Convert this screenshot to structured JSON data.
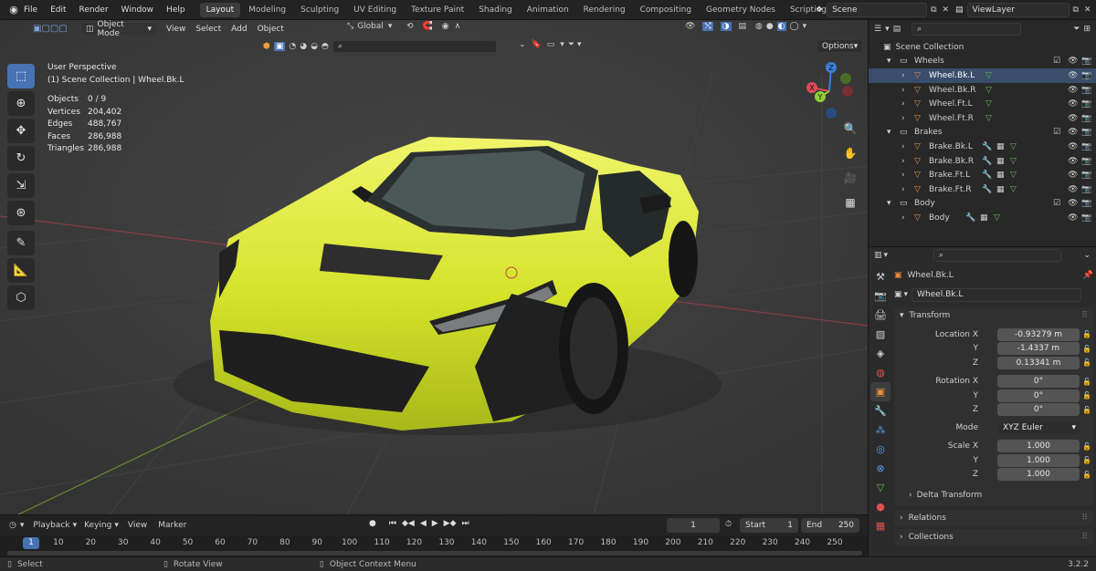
{
  "topbar": {
    "menus": [
      "File",
      "Edit",
      "Render",
      "Window",
      "Help"
    ],
    "workspaces": [
      "Layout",
      "Modeling",
      "Sculpting",
      "UV Editing",
      "Texture Paint",
      "Shading",
      "Animation",
      "Rendering",
      "Compositing",
      "Geometry Nodes",
      "Scripting"
    ],
    "active_workspace": "Layout",
    "add_workspace": "+",
    "scene_name": "Scene",
    "view_layer": "ViewLayer"
  },
  "viewport_header": {
    "mode": "Object Mode",
    "menus": [
      "View",
      "Select",
      "Add",
      "Object"
    ],
    "orientation": "Global",
    "options_label": "Options"
  },
  "viewport_info": {
    "perspective": "User Perspective",
    "context": "(1) Scene Collection | Wheel.Bk.L",
    "stats": [
      {
        "label": "Objects",
        "value": "0 / 9"
      },
      {
        "label": "Vertices",
        "value": "204,402"
      },
      {
        "label": "Edges",
        "value": "488,767"
      },
      {
        "label": "Faces",
        "value": "286,988"
      },
      {
        "label": "Triangles",
        "value": "286,988"
      }
    ]
  },
  "gizmo": {
    "x": "X",
    "y": "Y",
    "z": "Z"
  },
  "timeline": {
    "menus": [
      "Playback",
      "Keying",
      "View",
      "Marker"
    ],
    "current_frame": "1",
    "start_label": "Start",
    "start": "1",
    "end_label": "End",
    "end": "250",
    "playhead": "1",
    "ticks": [
      "10",
      "20",
      "30",
      "40",
      "50",
      "60",
      "70",
      "80",
      "90",
      "100",
      "110",
      "120",
      "130",
      "140",
      "150",
      "160",
      "170",
      "180",
      "190",
      "200",
      "210",
      "220",
      "230",
      "240",
      "250"
    ]
  },
  "statusbar": {
    "select": "Select",
    "rotate": "Rotate View",
    "context_menu": "Object Context Menu",
    "version": "3.2.2"
  },
  "outliner": {
    "root": "Scene Collection",
    "collections": [
      {
        "name": "Wheels",
        "objects": [
          "Wheel.Bk.L",
          "Wheel.Bk.R",
          "Wheel.Ft.L",
          "Wheel.Ft.R"
        ]
      },
      {
        "name": "Brakes",
        "objects": [
          "Brake.Bk.L",
          "Brake.Bk.R",
          "Brake.Ft.L",
          "Brake.Ft.R"
        ]
      },
      {
        "name": "Body",
        "objects": [
          "Body"
        ]
      }
    ]
  },
  "properties": {
    "object_name": "Wheel.Bk.L",
    "data_name": "Wheel.Bk.L",
    "transform_title": "Transform",
    "location": {
      "label_x": "Location X",
      "label_y": "Y",
      "label_z": "Z",
      "x": "-0.93279 m",
      "y": "-1.4337 m",
      "z": "0.13341 m"
    },
    "rotation": {
      "label_x": "Rotation X",
      "label_y": "Y",
      "label_z": "Z",
      "x": "0°",
      "y": "0°",
      "z": "0°"
    },
    "mode_label": "Mode",
    "mode_value": "XYZ Euler",
    "scale": {
      "label_x": "Scale X",
      "label_y": "Y",
      "label_z": "Z",
      "x": "1.000",
      "y": "1.000",
      "z": "1.000"
    },
    "delta_transform": "Delta Transform",
    "relations": "Relations",
    "collections": "Collections"
  },
  "colors": {
    "accent": "#4772b3",
    "car_body": "#d9e52a",
    "axis_x": "#e04a5a",
    "axis_y": "#8ccf3a",
    "axis_z": "#3a7fd9"
  }
}
